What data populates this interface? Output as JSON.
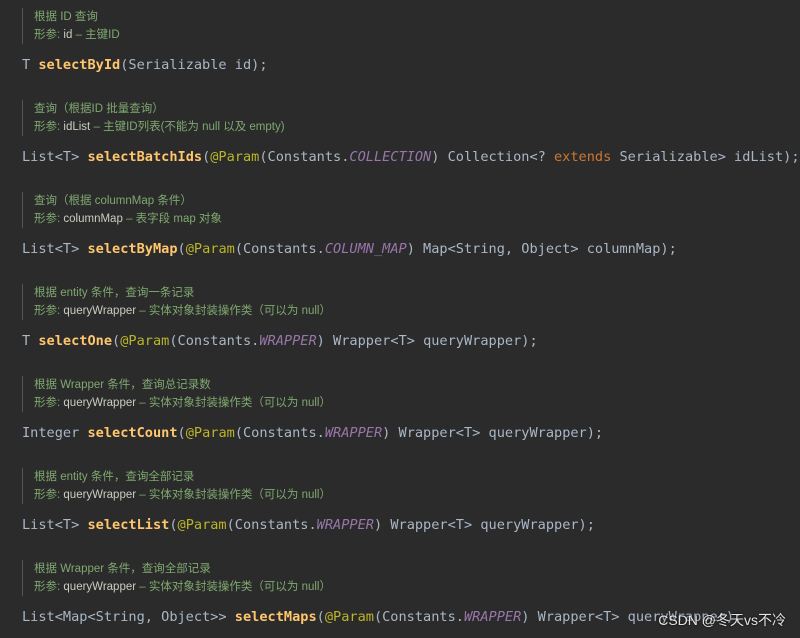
{
  "methods": [
    {
      "desc": "根据 ID 查询",
      "param_label": "形参:",
      "param_name": "id",
      "param_desc": "主键ID",
      "sig": [
        [
          "T ",
          "t"
        ],
        [
          "selectById",
          "m"
        ],
        [
          "(Serializable id);",
          "t"
        ]
      ]
    },
    {
      "desc": "查询（根据ID 批量查询）",
      "param_label": "形参:",
      "param_name": "idList",
      "param_desc": "主键ID列表(不能为 null 以及 empty)",
      "sig": [
        [
          "List<T> ",
          "t"
        ],
        [
          "selectBatchIds",
          "m"
        ],
        [
          "(",
          "t"
        ],
        [
          "@Param",
          "a"
        ],
        [
          "(Constants.",
          "t"
        ],
        [
          "COLLECTION",
          "c"
        ],
        [
          ") Collection<? ",
          "t"
        ],
        [
          "extends",
          "k"
        ],
        [
          " Serializable> idList);",
          "t"
        ]
      ]
    },
    {
      "desc": "查询（根据 columnMap 条件）",
      "param_label": "形参:",
      "param_name": "columnMap",
      "param_desc": "表字段 map 对象",
      "sig": [
        [
          "List<T> ",
          "t"
        ],
        [
          "selectByMap",
          "m"
        ],
        [
          "(",
          "t"
        ],
        [
          "@Param",
          "a"
        ],
        [
          "(Constants.",
          "t"
        ],
        [
          "COLUMN_MAP",
          "c"
        ],
        [
          ") Map<String, Object> columnMap);",
          "t"
        ]
      ]
    },
    {
      "desc": "根据 entity 条件，查询一条记录",
      "param_label": "形参:",
      "param_name": "queryWrapper",
      "param_desc": "实体对象封装操作类（可以为 null）",
      "sig": [
        [
          "T ",
          "t"
        ],
        [
          "selectOne",
          "m"
        ],
        [
          "(",
          "t"
        ],
        [
          "@Param",
          "a"
        ],
        [
          "(Constants.",
          "t"
        ],
        [
          "WRAPPER",
          "c"
        ],
        [
          ") Wrapper<T> queryWrapper);",
          "t"
        ]
      ]
    },
    {
      "desc": "根据 Wrapper 条件，查询总记录数",
      "param_label": "形参:",
      "param_name": "queryWrapper",
      "param_desc": "实体对象封装操作类（可以为 null）",
      "sig": [
        [
          "Integer ",
          "t"
        ],
        [
          "selectCount",
          "m"
        ],
        [
          "(",
          "t"
        ],
        [
          "@Param",
          "a"
        ],
        [
          "(Constants.",
          "t"
        ],
        [
          "WRAPPER",
          "c"
        ],
        [
          ") Wrapper<T> queryWrapper);",
          "t"
        ]
      ]
    },
    {
      "desc": "根据 entity 条件，查询全部记录",
      "param_label": "形参:",
      "param_name": "queryWrapper",
      "param_desc": "实体对象封装操作类（可以为 null）",
      "sig": [
        [
          "List<T> ",
          "t"
        ],
        [
          "selectList",
          "m"
        ],
        [
          "(",
          "t"
        ],
        [
          "@Param",
          "a"
        ],
        [
          "(Constants.",
          "t"
        ],
        [
          "WRAPPER",
          "c"
        ],
        [
          ") Wrapper<T> queryWrapper);",
          "t"
        ]
      ]
    },
    {
      "desc": "根据 Wrapper 条件，查询全部记录",
      "param_label": "形参:",
      "param_name": "queryWrapper",
      "param_desc": "实体对象封装操作类（可以为 null）",
      "sig": [
        [
          "List<Map<String, Object>> ",
          "t"
        ],
        [
          "selectMaps",
          "m"
        ],
        [
          "(",
          "t"
        ],
        [
          "@Param",
          "a"
        ],
        [
          "(Constants.",
          "t"
        ],
        [
          "WRAPPER",
          "c"
        ],
        [
          ") Wrapper<T> queryWrapper);",
          "t"
        ]
      ]
    }
  ],
  "watermark": "CSDN @冬天vs不冷",
  "dash": "–"
}
